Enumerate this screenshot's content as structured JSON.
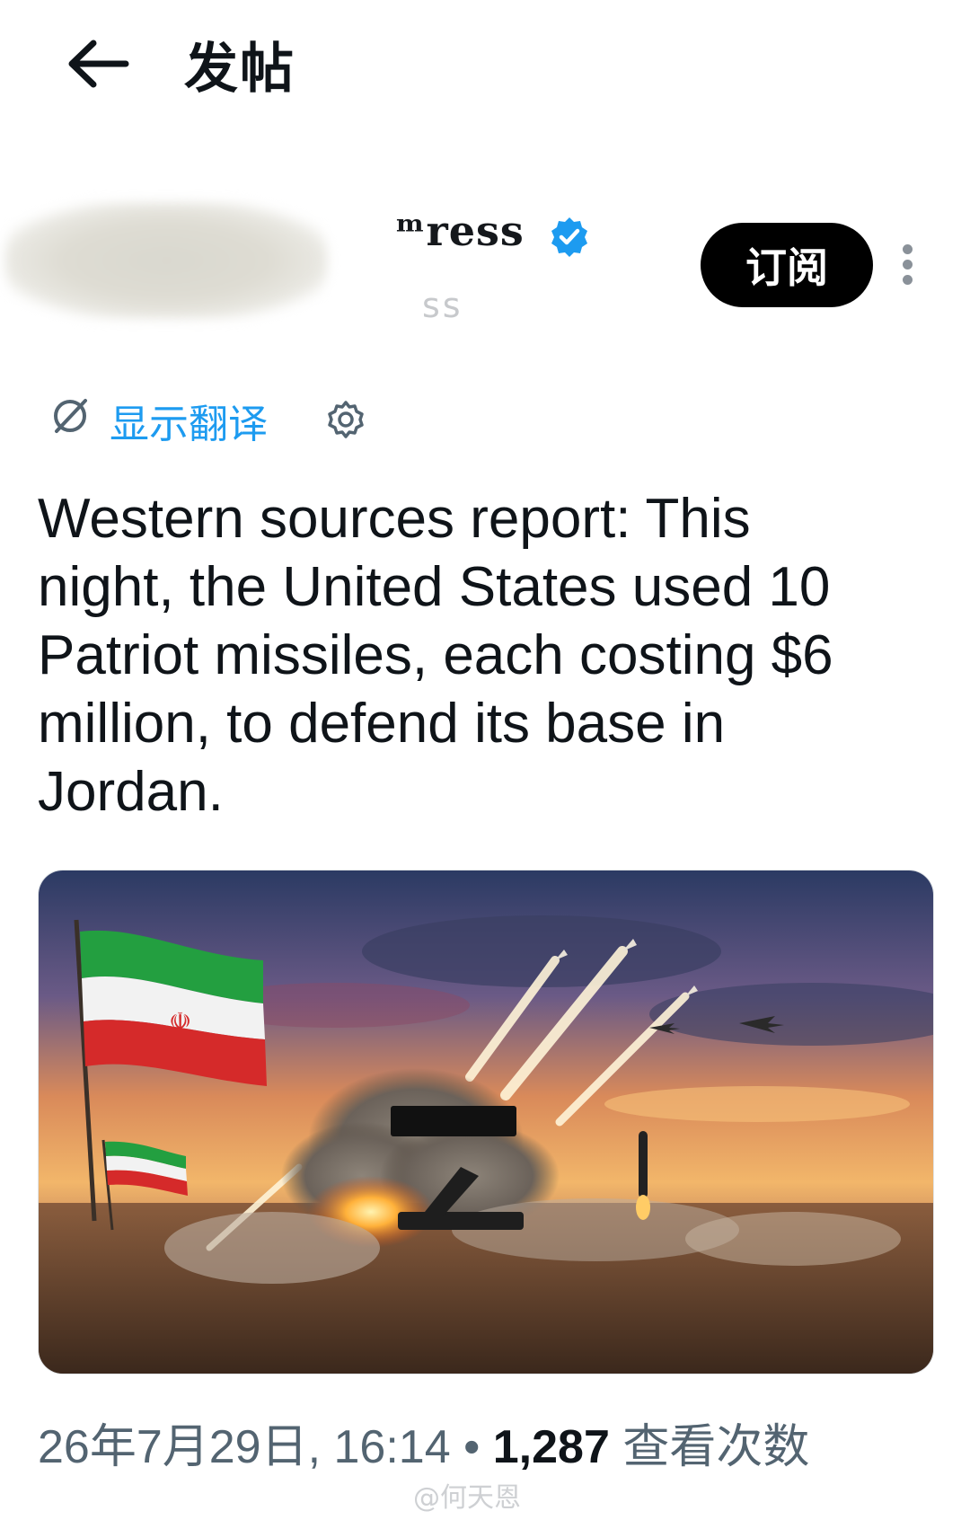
{
  "header": {
    "back_icon": "arrow-left-icon",
    "title": "发帖"
  },
  "author": {
    "name_visible": "ᵐress",
    "verified_icon": "verified-badge-icon",
    "handle_visible": "ss",
    "subscribe_label": "订阅",
    "more_icon": "more-vertical-icon"
  },
  "translate": {
    "icon": "translate-globe-icon",
    "label": "显示翻译",
    "settings_icon": "gear-icon"
  },
  "tweet": {
    "text": "Western sources report: This night, the United States used 10 Patriot missiles, each costing $6 million, to defend its base in Jordan."
  },
  "meta": {
    "datetime": "26年7月29日, 16:14",
    "separator": "•",
    "views_count": "1,287",
    "views_label": "查看次数"
  },
  "watermark": {
    "text": "@何天恩"
  },
  "colors": {
    "link": "#1d9bf0",
    "verified": "#1d9bf0",
    "text": "#0f1419",
    "secondary": "#536471",
    "button_bg": "#000000"
  }
}
